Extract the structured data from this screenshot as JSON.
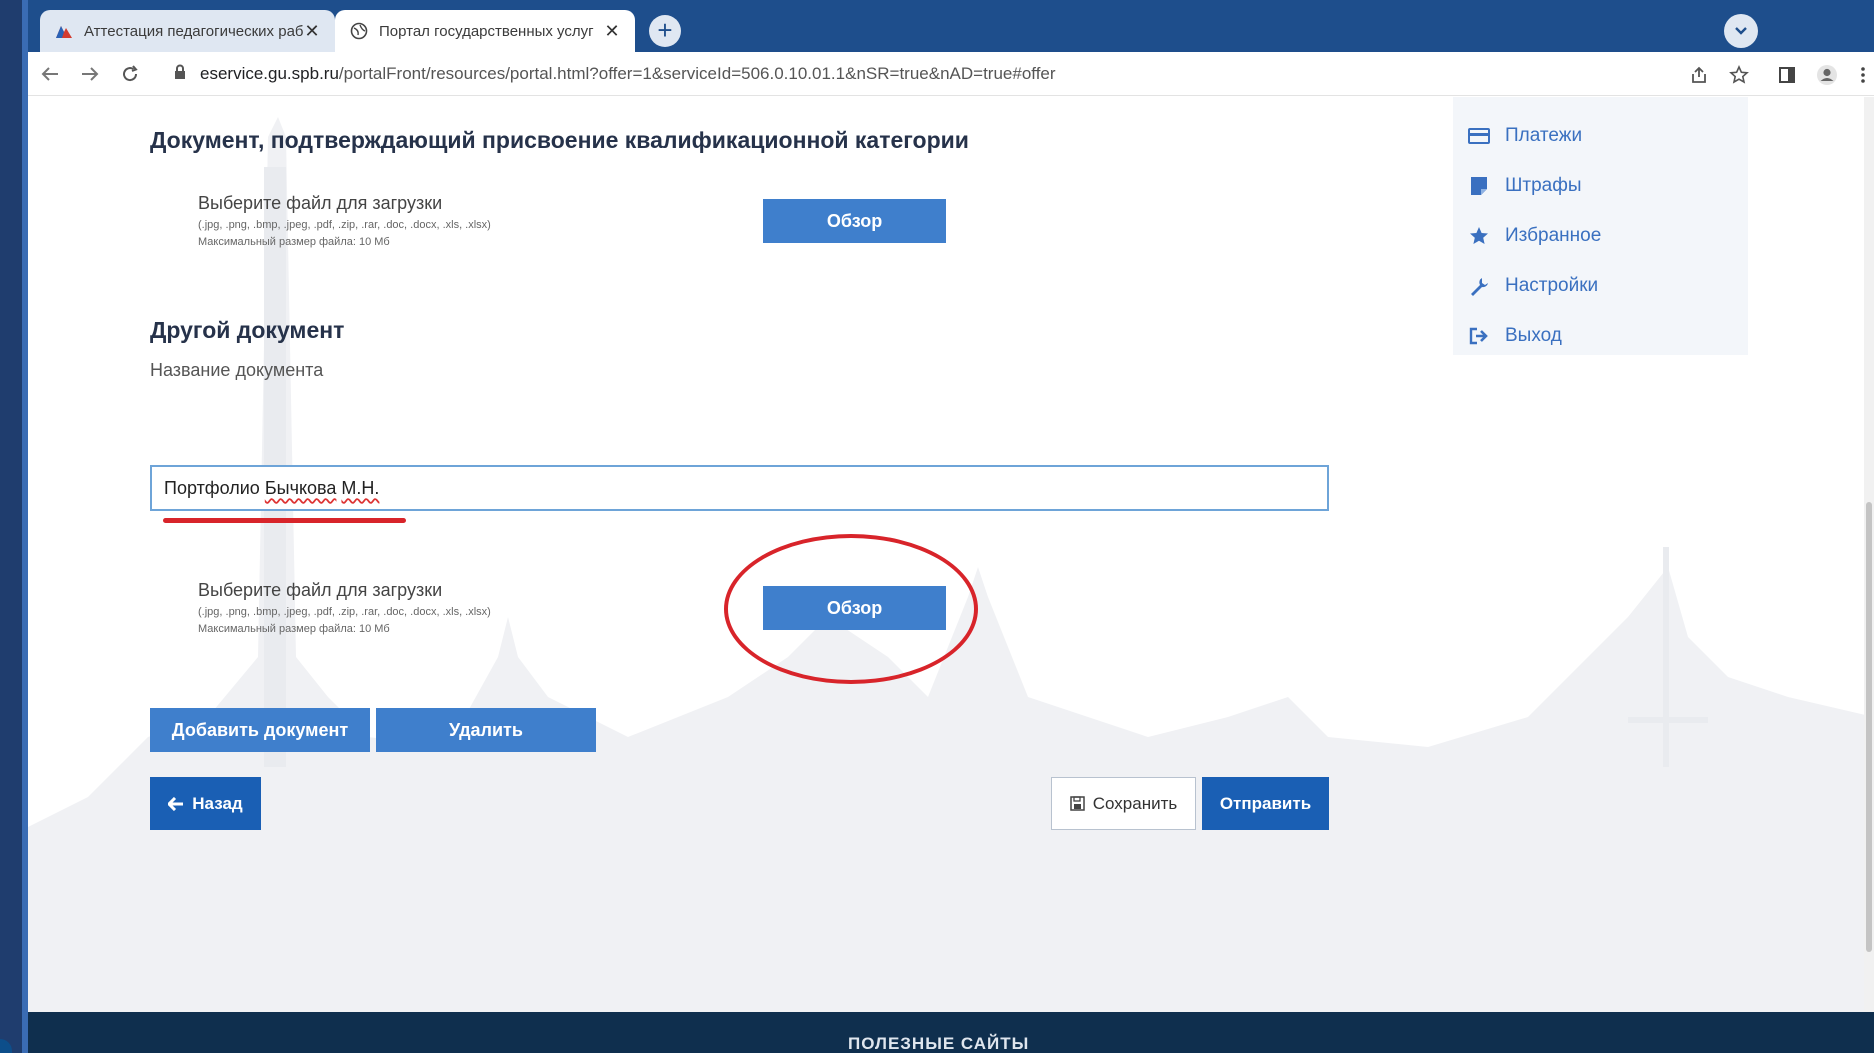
{
  "browser": {
    "tabs": [
      {
        "label": "Аттестация педагогических раб",
        "active": false
      },
      {
        "label": "Портал государственных услуг",
        "active": true
      }
    ],
    "new_tab_icon": "plus-icon",
    "url_host": "eservice.gu.spb.ru",
    "url_path": "/portalFront/resources/portal.html?offer=1&serviceId=506.0.10.01.1&nSR=true&nAD=true#offer"
  },
  "section1": {
    "title": "Документ, подтверждающий присвоение квалификационной категории",
    "upload_title": "Выберите файл для загрузки",
    "upload_formats": "(.jpg, .png, .bmp, .jpeg, .pdf, .zip, .rar, .doc, .docx, .xls, .xlsx)",
    "upload_max_size": "Максимальный размер файла: 10 Мб",
    "browse_label": "Обзор"
  },
  "section2": {
    "title": "Другой документ",
    "doc_name_label": "Название документа",
    "doc_name_prefix": "Портфолио ",
    "doc_name_word": "Бычкова",
    "doc_name_space": " ",
    "doc_name_initials": "М.Н.",
    "upload_title": "Выберите файл для загрузки",
    "upload_formats": "(.jpg, .png, .bmp, .jpeg, .pdf, .zip, .rar, .doc, .docx, .xls, .xlsx)",
    "upload_max_size": "Максимальный размер файла: 10 Мб",
    "browse_label": "Обзор"
  },
  "actions": {
    "add_document": "Добавить документ",
    "delete": "Удалить",
    "back": "Назад",
    "save": "Сохранить",
    "submit": "Отправить"
  },
  "sidebar": {
    "items": [
      {
        "label": "Платежи",
        "icon": "credit-card-icon"
      },
      {
        "label": "Штрафы",
        "icon": "fine-icon"
      },
      {
        "label": "Избранное",
        "icon": "star-icon"
      },
      {
        "label": "Настройки",
        "icon": "wrench-icon"
      },
      {
        "label": "Выход",
        "icon": "logout-icon"
      }
    ]
  },
  "footer": {
    "label": "ПОЛЕЗНЫЕ САЙТЫ"
  },
  "colors": {
    "accent": "#3f7fcc",
    "primary_dark": "#1a5fb4",
    "annotation_red": "#d8242a",
    "tabbar": "#1e4e8c"
  }
}
